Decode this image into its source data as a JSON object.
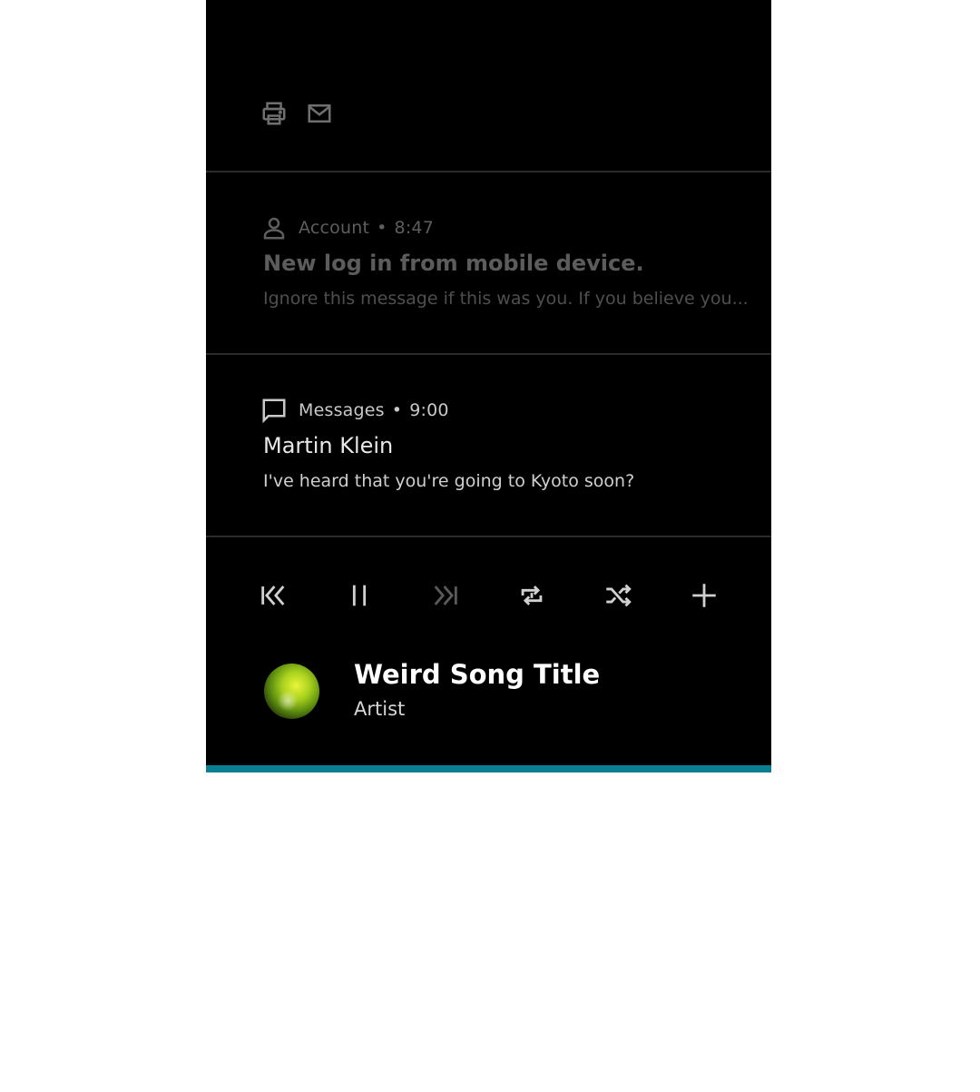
{
  "top_actions": {
    "icons": [
      "printer-icon",
      "mail-icon"
    ]
  },
  "notifications": [
    {
      "icon": "person-icon",
      "app_name": "Account",
      "separator": "•",
      "time": "8:47",
      "title": "New log in from mobile device.",
      "body": "Ignore this message if this was you. If you believe you..."
    },
    {
      "icon": "chat-bubble-icon",
      "app_name": "Messages",
      "separator": "•",
      "time": "9:00",
      "title": "Martin Klein",
      "body": "I've heard that you're going to Kyoto soon?"
    }
  ],
  "media": {
    "controls": [
      "skip-previous-icon",
      "pause-icon",
      "skip-next-icon",
      "repeat-icon",
      "shuffle-icon",
      "add-icon"
    ],
    "song_title": "Weird Song Title",
    "artist": "Artist",
    "progress": 1.0,
    "colors": {
      "progress_fill": "#0a7f92",
      "album_art_primary": "#c6e02a"
    }
  },
  "colors": {
    "panel_background": "#000000",
    "page_background": "#ffffff",
    "divider": "#2a2a2a"
  }
}
